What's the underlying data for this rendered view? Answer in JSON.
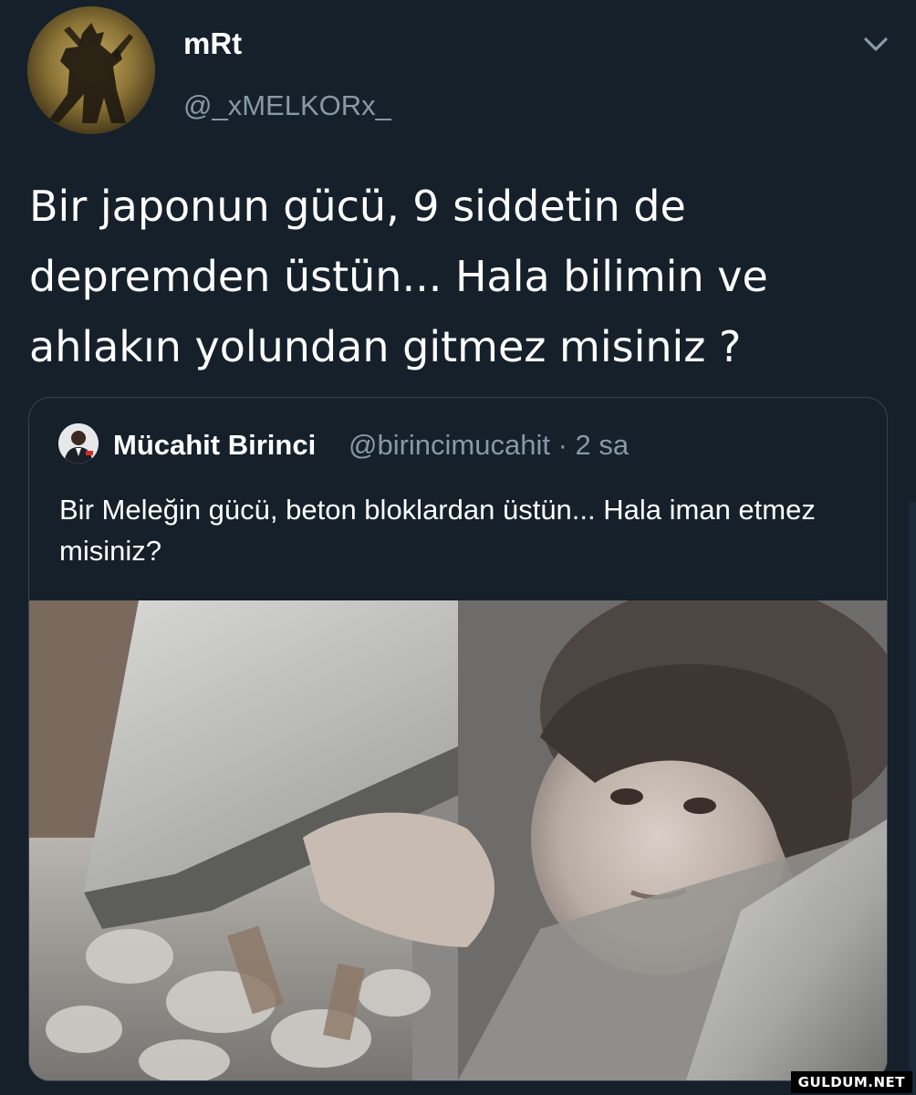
{
  "tweet": {
    "author": {
      "display_name": "mRt",
      "handle": "@_xMELKORx_",
      "avatar_icon": "warrior-avatar"
    },
    "menu_icon": "chevron-down-icon",
    "text": "Bir japonun gücü, 9 siddetin de depremden üstün... Hala bilimin ve ahlakın yolundan gitmez misiniz ?"
  },
  "quoted_tweet": {
    "author": {
      "display_name": "Mücahit Birinci",
      "handle": "@birincimucahit",
      "time": "· 2 sa",
      "avatar_icon": "person-avatar"
    },
    "text": "Bir Meleğin gücü, beton bloklardan üstün... Hala iman etmez misiniz?",
    "media": {
      "type": "photo"
    }
  },
  "watermark": "GULDUM.NET",
  "colors": {
    "background": "#15202b",
    "text_primary": "#ffffff",
    "text_secondary": "#8899a6",
    "border": "#38444d"
  }
}
